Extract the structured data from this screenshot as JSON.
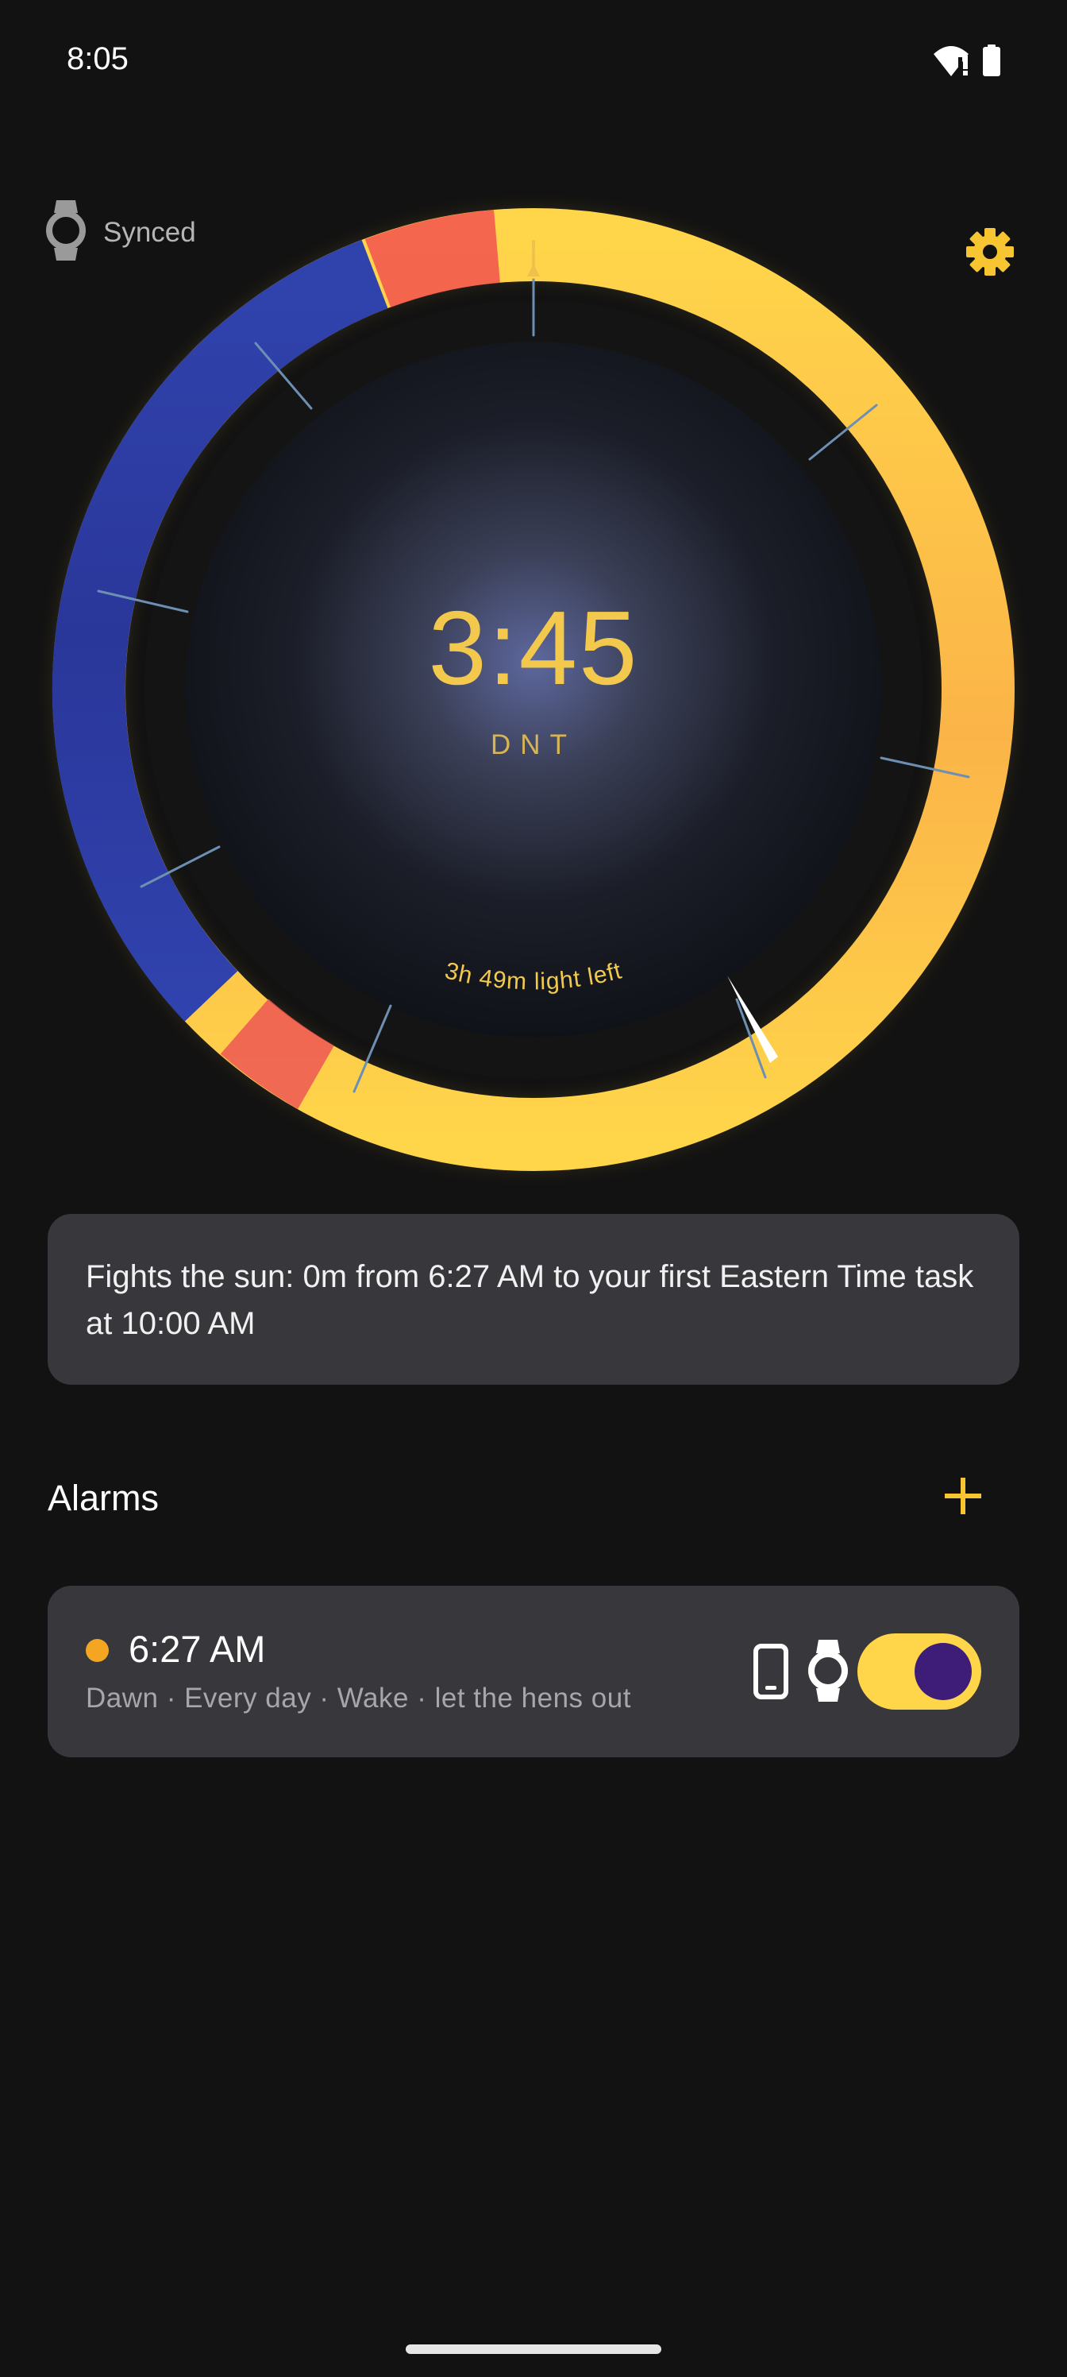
{
  "status_bar": {
    "time": "8:05",
    "icons": [
      "wifi-warning-icon",
      "battery-icon"
    ]
  },
  "sync": {
    "icon": "watch-icon",
    "label": "Synced"
  },
  "settings": {
    "icon": "gear-icon"
  },
  "dial": {
    "time": "3:45",
    "mode": "DNT",
    "light_left": "3h 49m light left",
    "colors": {
      "day": "#ffd54a",
      "night": "#2f3ba0",
      "twilight": "#ee5b4f"
    }
  },
  "info_card": {
    "text": "Fights the sun: 0m from 6:27 AM to your first Eastern Time task at 10:00 AM"
  },
  "alarms": {
    "title": "Alarms",
    "add_icon": "plus-icon",
    "items": [
      {
        "time": "6:27 AM",
        "meta": "Dawn · Every day · Wake · let the hens out",
        "dot_color": "#f4a623",
        "devices": [
          "phone-icon",
          "watch-icon"
        ],
        "enabled": true
      }
    ]
  }
}
